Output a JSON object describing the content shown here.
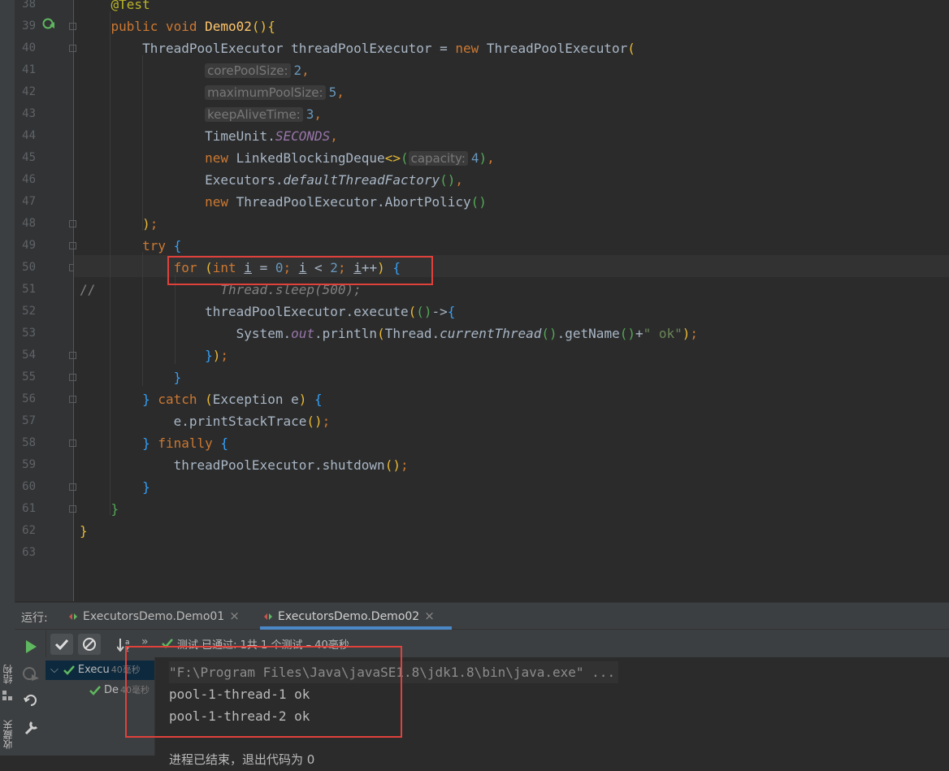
{
  "editor": {
    "lines": [
      {
        "num": "38",
        "html": "    <span class=\"ann\">@Test</span>"
      },
      {
        "num": "39",
        "html": "    <span class=\"kw\">public void </span><span class=\"fn\">Demo02</span><span class=\"br-y\">()</span><span class=\"br-y\">{</span>"
      },
      {
        "num": "40",
        "html": "        ThreadPoolExecutor threadPoolExecutor = <span class=\"kw\">new </span>ThreadPoolExecutor<span class=\"br-y\">(</span>"
      },
      {
        "num": "41",
        "html": "                <span class=\"hint\">corePoolSize:</span><span class=\"num\">2</span><span class=\"kw\">,</span>"
      },
      {
        "num": "42",
        "html": "                <span class=\"hint\">maximumPoolSize:</span><span class=\"num\">5</span><span class=\"kw\">,</span>"
      },
      {
        "num": "43",
        "html": "                <span class=\"hint\">keepAliveTime:</span><span class=\"num\">3</span><span class=\"kw\">,</span>"
      },
      {
        "num": "44",
        "html": "                TimeUnit.<span class=\"static-i\">SECONDS</span><span class=\"kw\">,</span>"
      },
      {
        "num": "45",
        "html": "                <span class=\"kw\">new </span>LinkedBlockingDeque<span class=\"br-y\">&lt;&gt;</span><span class=\"br-g\">(</span><span class=\"hint\">capacity:</span><span class=\"num\">4</span><span class=\"br-g\">)</span><span class=\"kw\">,</span>"
      },
      {
        "num": "46",
        "html": "                Executors.<span class=\"ital\">defaultThreadFactory</span><span class=\"br-g\">()</span><span class=\"kw\">,</span>"
      },
      {
        "num": "47",
        "html": "                <span class=\"kw\">new </span>ThreadPoolExecutor.AbortPolicy<span class=\"br-g\">()</span>"
      },
      {
        "num": "48",
        "html": "        <span class=\"br-y\">)</span><span class=\"kw\">;</span>"
      },
      {
        "num": "49",
        "html": "        <span class=\"kw\">try </span><span class=\"br-b\">{</span>"
      },
      {
        "num": "50",
        "html": "            <span class=\"kw\">for </span><span class=\"br-y\">(</span><span class=\"kw\">int </span><span class=\"und\">i</span> = <span class=\"num\">0</span><span class=\"kw\">; </span><span class=\"und\">i</span> &lt; <span class=\"num\">2</span><span class=\"kw\">; </span><span class=\"und\">i</span>++<span class=\"br-y\">)</span> <span class=\"br-b\">{</span>"
      },
      {
        "num": "51",
        "html": "<span class=\"comment\">//</span><span class=\"cmt-i\">                Thread.sleep(500);</span>"
      },
      {
        "num": "52",
        "html": "                threadPoolExecutor.execute<span class=\"br-y\">(</span><span class=\"br-g\">()</span>-&gt;<span class=\"br-b\">{</span>"
      },
      {
        "num": "53",
        "html": "                    System.<span class=\"field-i\">out</span>.println<span class=\"br-y\">(</span>Thread.<span class=\"ital\">currentThread</span><span class=\"br-g\">()</span>.getName<span class=\"br-g\">()</span>+<span class=\"str\">\" ok\"</span><span class=\"br-y\">)</span><span class=\"kw\">;</span>"
      },
      {
        "num": "54",
        "html": "                <span class=\"br-b\">}</span><span class=\"br-y\">)</span><span class=\"kw\">;</span>"
      },
      {
        "num": "55",
        "html": "            <span class=\"br-b\">}</span>"
      },
      {
        "num": "56",
        "html": "        <span class=\"br-b\">}</span> <span class=\"kw\">catch </span><span class=\"br-y\">(</span>Exception e<span class=\"br-y\">)</span> <span class=\"br-b\">{</span>"
      },
      {
        "num": "57",
        "html": "            e.printStackTrace<span class=\"br-y\">()</span><span class=\"kw\">;</span>"
      },
      {
        "num": "58",
        "html": "        <span class=\"br-b\">}</span> <span class=\"kw\">finally </span><span class=\"br-b\">{</span>"
      },
      {
        "num": "59",
        "html": "            threadPoolExecutor.shutdown<span class=\"br-y\">()</span><span class=\"kw\">;</span>"
      },
      {
        "num": "60",
        "html": "        <span class=\"br-b\">}</span>"
      },
      {
        "num": "61",
        "html": "    <span class=\"br-g\">}</span>"
      },
      {
        "num": "62",
        "html": "<span class=\"br-y\">}</span>"
      },
      {
        "num": "63",
        "html": ""
      }
    ]
  },
  "run_panel": {
    "label": "运行:",
    "tabs": [
      {
        "label": "ExecutorsDemo.Demo01",
        "close": "×"
      },
      {
        "label": "ExecutorsDemo.Demo02",
        "close": "×"
      }
    ],
    "status_text": "测试 已通过: 1共 1 个测试 – 40毫秒",
    "chevron": "»",
    "tree": [
      {
        "label": "Execu",
        "time": "40毫秒"
      },
      {
        "label": "De",
        "time": "40毫秒"
      }
    ],
    "console": [
      "\"F:\\Program Files\\Java\\javaSE1.8\\jdk1.8\\bin\\java.exe\" ...",
      "pool-1-thread-1 ok",
      "pool-1-thread-2 ok",
      "",
      "进程已结束，退出代码为 0"
    ]
  },
  "side_labels": {
    "structure": "结构",
    "favorites": "收藏夹"
  },
  "colors": {
    "accent": "#4a88c7",
    "pass_green": "#5fb85f",
    "highlight_red": "#e0413b"
  }
}
